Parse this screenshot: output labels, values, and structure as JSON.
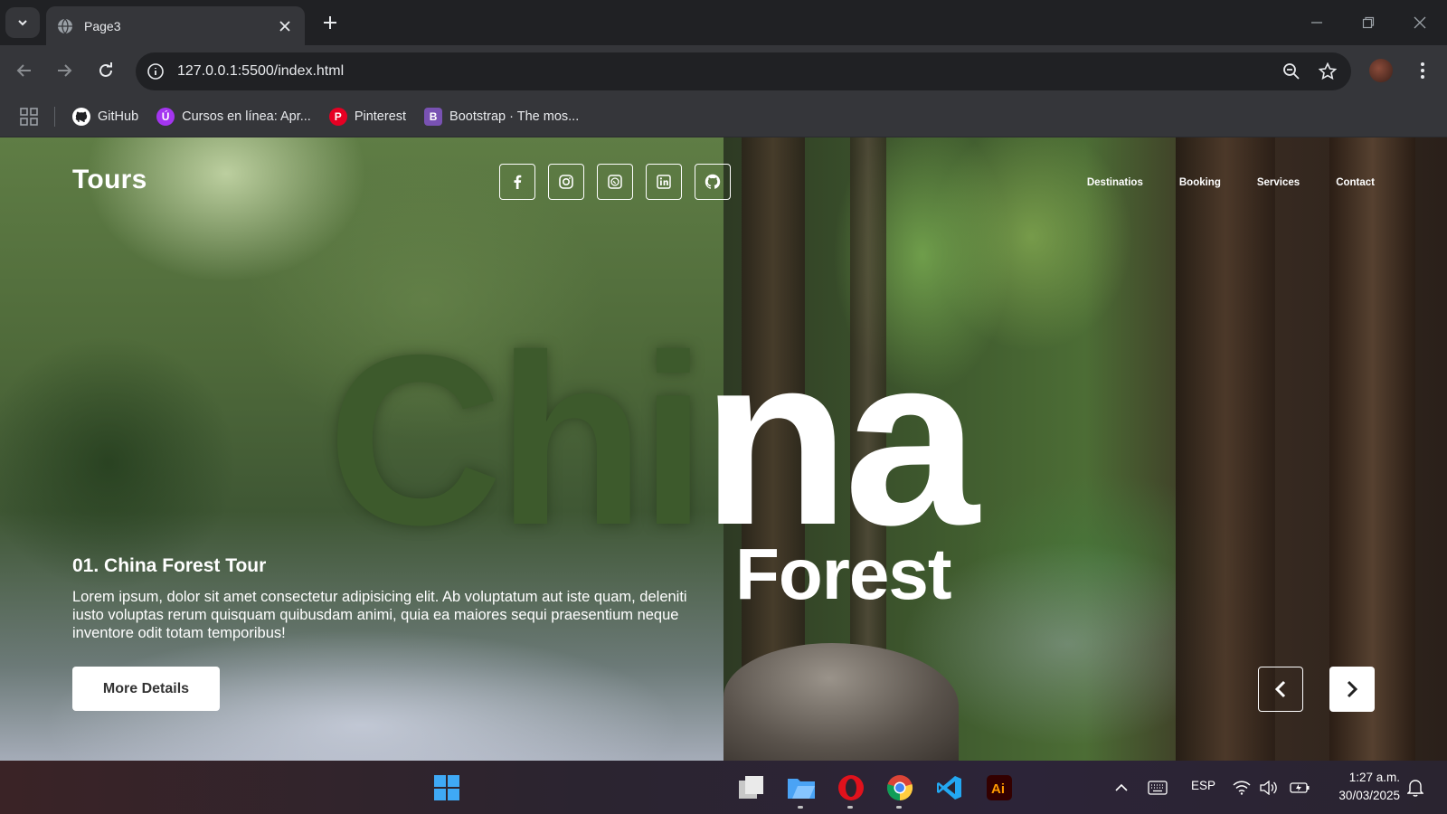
{
  "browser": {
    "tab": {
      "title": "Page3"
    },
    "url": "127.0.0.1:5500/index.html",
    "bookmarks": [
      {
        "label": "GitHub",
        "icon": "github-icon",
        "color": "#ffffff"
      },
      {
        "label": "Cursos en línea: Apr...",
        "icon": "udemy-icon",
        "color": "#a435f0"
      },
      {
        "label": "Pinterest",
        "icon": "pinterest-icon",
        "color": "#e60023"
      },
      {
        "label": "Bootstrap · The mos...",
        "icon": "bootstrap-icon",
        "color": "#7952b3"
      }
    ]
  },
  "site": {
    "brand": "Tours",
    "socials": [
      "facebook-icon",
      "instagram-icon",
      "whatsapp-icon",
      "linkedin-icon",
      "github-icon"
    ],
    "nav": [
      "Destinatios",
      "Booking",
      "Services",
      "Contact"
    ],
    "hero": {
      "title_left": "Chi",
      "title_right": "na",
      "subtitle": "Forest"
    },
    "tour": {
      "title": "01. China Forest Tour",
      "description": "Lorem ipsum, dolor sit amet consectetur adipisicing elit. Ab voluptatum aut iste quam, deleniti iusto voluptas rerum quisquam quibusdam animi, quia ea maiores sequi praesentium neque inventore odit totam temporibus!",
      "button": "More Details"
    }
  },
  "taskbar": {
    "language": "ESP",
    "time": "1:27 a.m.",
    "date": "30/03/2025"
  }
}
